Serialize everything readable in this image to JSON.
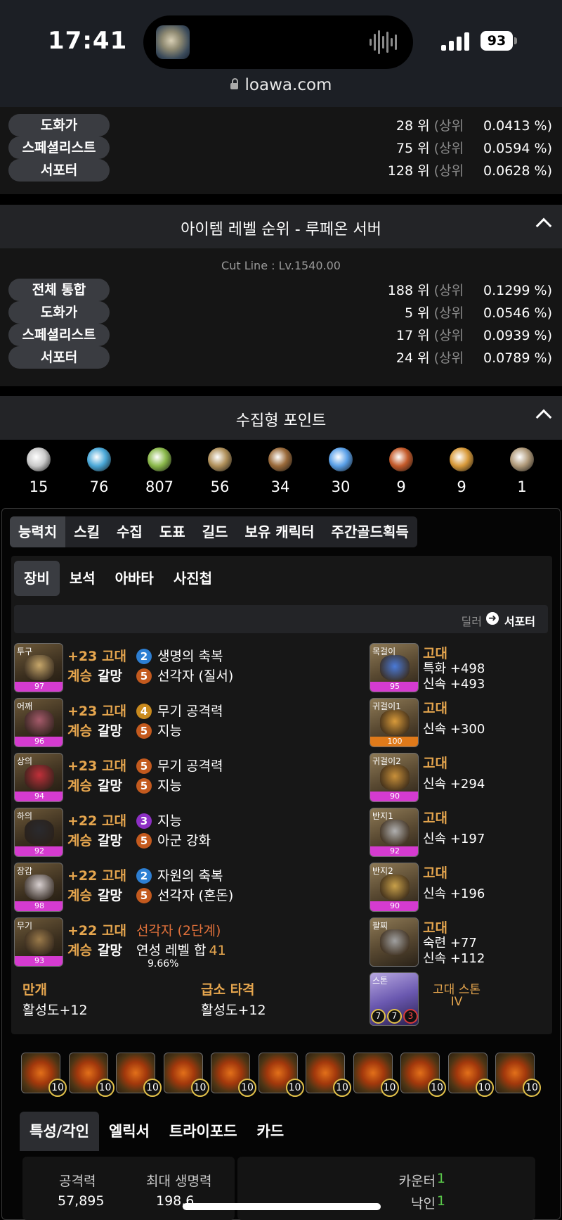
{
  "status": {
    "time": "17:41",
    "battery": "93",
    "url": "loawa.com"
  },
  "top_rank": {
    "rows": [
      {
        "label": "도화가",
        "rank": "28 위",
        "pct_label": "(상위",
        "pct": "0.0413 %)"
      },
      {
        "label": "스페셜리스트",
        "rank": "75 위",
        "pct_label": "(상위",
        "pct": "0.0594 %)"
      },
      {
        "label": "서포터",
        "rank": "128 위",
        "pct_label": "(상위",
        "pct": "0.0628 %)"
      }
    ]
  },
  "item_rank": {
    "title": "아이템 레벨 순위 - 루페온 서버",
    "cutline": "Cut Line : Lv.1540.00",
    "rows": [
      {
        "label": "전체 통합",
        "rank": "188 위",
        "pct_label": "(상위",
        "pct": "0.1299 %)"
      },
      {
        "label": "도화가",
        "rank": "5 위",
        "pct_label": "(상위",
        "pct": "0.0546 %)"
      },
      {
        "label": "스페셜리스트",
        "rank": "17 위",
        "pct_label": "(상위",
        "pct": "0.0939 %)"
      },
      {
        "label": "서포터",
        "rank": "24 위",
        "pct_label": "(상위",
        "pct": "0.0789 %)"
      }
    ]
  },
  "collection": {
    "title": "수집형 포인트",
    "items": [
      {
        "icon": "heart-seed-icon",
        "value": "15",
        "color": "#c9c9c9"
      },
      {
        "icon": "island-heart-icon",
        "value": "76",
        "color": "#4aa8d8"
      },
      {
        "icon": "mokoko-seed-icon",
        "value": "807",
        "color": "#8ab84a"
      },
      {
        "icon": "art-icon",
        "value": "56",
        "color": "#b0905a"
      },
      {
        "icon": "voyage-icon",
        "value": "34",
        "color": "#9a6a3a"
      },
      {
        "icon": "leaf-icon",
        "value": "30",
        "color": "#5aa0e8"
      },
      {
        "icon": "medal-icon",
        "value": "9",
        "color": "#c45a2a"
      },
      {
        "icon": "star-icon",
        "value": "9",
        "color": "#d89a3a"
      },
      {
        "icon": "orb-icon",
        "value": "1",
        "color": "#b09a7a"
      }
    ]
  },
  "tabs_main": [
    "능력치",
    "스킬",
    "수집",
    "도표",
    "길드",
    "보유 캐릭터",
    "주간골드획득"
  ],
  "tabs_sub": [
    "장비",
    "보석",
    "아바타",
    "사진첩"
  ],
  "role_toggle": {
    "from": "딜러",
    "to": "서포터"
  },
  "equipment": [
    {
      "slot": "투구",
      "quality": "97",
      "enhance": "+23 고대",
      "tier": "계승",
      "set": "갈망",
      "engr": [
        {
          "lv": "2",
          "name": "생명의 축복",
          "c": "blue"
        },
        {
          "lv": "5",
          "name": "선각자 (질서)",
          "c": "orange"
        }
      ],
      "art": "#c7a76a"
    },
    {
      "slot": "어깨",
      "quality": "96",
      "enhance": "+23 고대",
      "tier": "계승",
      "set": "갈망",
      "engr": [
        {
          "lv": "4",
          "name": "무기 공격력",
          "c": "gold"
        },
        {
          "lv": "5",
          "name": "지능",
          "c": "orange"
        }
      ],
      "art": "#a55a6a"
    },
    {
      "slot": "상의",
      "quality": "94",
      "enhance": "+23 고대",
      "tier": "계승",
      "set": "갈망",
      "engr": [
        {
          "lv": "5",
          "name": "무기 공격력",
          "c": "orange"
        },
        {
          "lv": "5",
          "name": "지능",
          "c": "orange"
        }
      ],
      "art": "#c0303a"
    },
    {
      "slot": "하의",
      "quality": "92",
      "enhance": "+22 고대",
      "tier": "계승",
      "set": "갈망",
      "engr": [
        {
          "lv": "3",
          "name": "지능",
          "c": "purple"
        },
        {
          "lv": "5",
          "name": "아군 강화",
          "c": "orange"
        }
      ],
      "art": "#2a2a2e"
    },
    {
      "slot": "장갑",
      "quality": "98",
      "enhance": "+22 고대",
      "tier": "계승",
      "set": "갈망",
      "engr": [
        {
          "lv": "2",
          "name": "자원의 축복",
          "c": "blue"
        },
        {
          "lv": "5",
          "name": "선각자 (혼돈)",
          "c": "orange"
        }
      ],
      "art": "#d8d0d0"
    },
    {
      "slot": "무기",
      "quality": "93",
      "enhance": "+22 고대",
      "tier": "계승",
      "set": "갈망",
      "weapon_extra": {
        "line1": "선각자 (2단계)",
        "line2_prefix": "연성 레벨 합",
        "line2_val": "41",
        "line3": "9.66%"
      },
      "art": "#9a7a4a"
    }
  ],
  "specials": [
    {
      "title": "만개",
      "value": "활성도+12"
    },
    {
      "title": "급소 타격",
      "value": "활성도+12"
    }
  ],
  "accessories": [
    {
      "slot": "목걸이",
      "quality": "95",
      "grade": "고대",
      "stats": [
        "특화 +498",
        "신속 +493"
      ],
      "art": "#4a7ad8"
    },
    {
      "slot": "귀걸이1",
      "quality": "100",
      "grade": "고대",
      "stats": [
        "신속 +300"
      ],
      "art": "#d89a3a",
      "q_orange": true
    },
    {
      "slot": "귀걸이2",
      "quality": "90",
      "grade": "고대",
      "stats": [
        "신속 +294"
      ],
      "art": "#c8903a"
    },
    {
      "slot": "반지1",
      "quality": "92",
      "grade": "고대",
      "stats": [
        "신속 +197"
      ],
      "art": "#b0b0b0"
    },
    {
      "slot": "반지2",
      "quality": "90",
      "grade": "고대",
      "stats": [
        "신속 +196"
      ],
      "art": "#c8a04a"
    },
    {
      "slot": "팔찌",
      "quality": "",
      "grade": "고대",
      "stats": [
        "숙련 +77",
        "신속 +112"
      ],
      "art": "#a0a0a0"
    }
  ],
  "stone": {
    "slot": "스톤",
    "name": "고대 스톤",
    "tier": "IV",
    "levels": [
      "7",
      "7",
      "3"
    ]
  },
  "gems": [
    "10",
    "10",
    "10",
    "10",
    "10",
    "10",
    "10",
    "10",
    "10",
    "10",
    "10"
  ],
  "tabs_bottom": [
    "특성/각인",
    "엘릭서",
    "트라이포드",
    "카드"
  ],
  "stats": {
    "atk_label": "공격력",
    "atk_value": "57,895",
    "hp_label": "최대 생명력",
    "hp_value": "198,6..",
    "right": [
      {
        "label": "카운터",
        "value": "1"
      },
      {
        "label": "낙인",
        "value": "1"
      }
    ]
  }
}
